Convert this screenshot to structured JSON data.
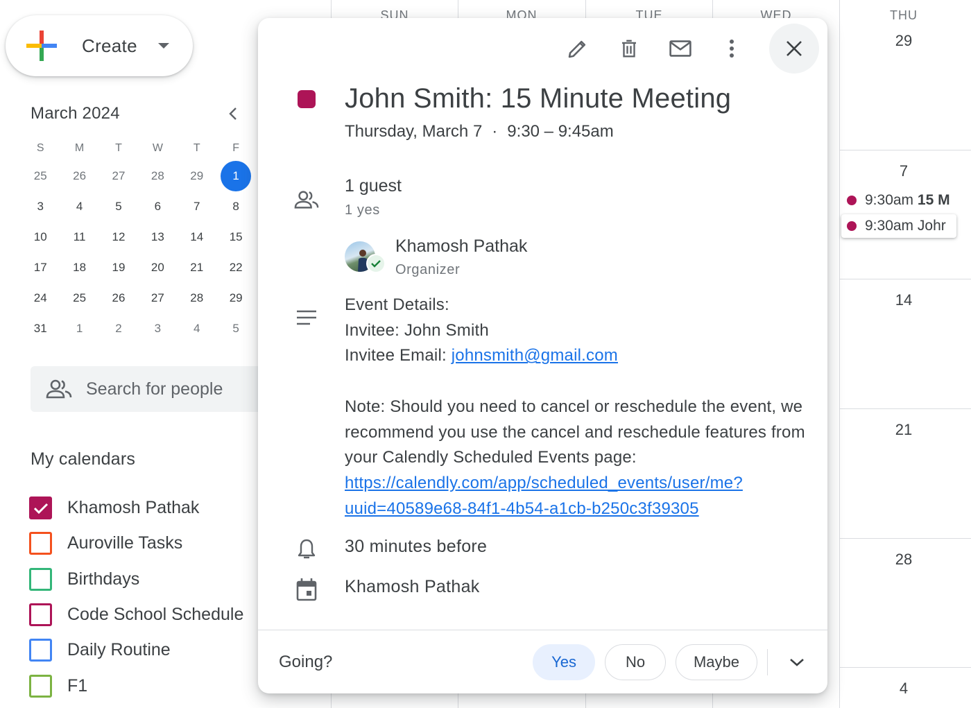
{
  "create": {
    "label": "Create"
  },
  "mini_calendar": {
    "title": "March 2024",
    "weekdays": [
      "S",
      "M",
      "T",
      "W",
      "T",
      "F"
    ],
    "weeks": [
      [
        "25",
        "26",
        "27",
        "28",
        "29",
        "1"
      ],
      [
        "3",
        "4",
        "5",
        "6",
        "7",
        "8"
      ],
      [
        "10",
        "11",
        "12",
        "13",
        "14",
        "15"
      ],
      [
        "17",
        "18",
        "19",
        "20",
        "21",
        "22"
      ],
      [
        "24",
        "25",
        "26",
        "27",
        "28",
        "29"
      ],
      [
        "31",
        "1",
        "2",
        "3",
        "4",
        "5"
      ]
    ]
  },
  "search": {
    "placeholder": "Search for people"
  },
  "my_calendars": {
    "title": "My calendars",
    "items": [
      {
        "name": "Khamosh Pathak",
        "color": "#ad1457",
        "checked": true
      },
      {
        "name": "Auroville Tasks",
        "color": "#f4511e",
        "checked": false
      },
      {
        "name": "Birthdays",
        "color": "#33b679",
        "checked": false
      },
      {
        "name": "Code School Schedule",
        "color": "#ad1457",
        "checked": false
      },
      {
        "name": "Daily Routine",
        "color": "#4285f4",
        "checked": false
      },
      {
        "name": "F1",
        "color": "#7cb342",
        "checked": false
      }
    ]
  },
  "week_view": {
    "col_headers": [
      "SUN",
      "MON",
      "TUE",
      "WED",
      "THU"
    ],
    "thu_dates": [
      "29",
      "7",
      "14",
      "21",
      "28",
      "4"
    ],
    "events": [
      {
        "time": "9:30am",
        "title": "15 M"
      },
      {
        "time": "9:30am",
        "title": "Johr"
      }
    ]
  },
  "event": {
    "color": "#ad1457",
    "title": "John Smith: 15 Minute Meeting",
    "date": "Thursday, March 7",
    "separator": "·",
    "time": "9:30 – 9:45am",
    "guests": {
      "count_label": "1 guest",
      "summary": "1 yes",
      "organizer_name": "Khamosh Pathak",
      "organizer_role": "Organizer"
    },
    "description": {
      "line1": "Event Details:",
      "line2": "Invitee: John Smith",
      "email_label": "Invitee Email: ",
      "email": "johnsmith@gmail.com",
      "note": "Note: Should you need to cancel or reschedule the event, we recommend you use the cancel and reschedule features from your Calendly Scheduled Events page:",
      "link_line1": "https://calendly.com/app/scheduled_events/user/me?",
      "link_line2": "uuid=40589e68-84f1-4b54-a1cb-b250c3f39305"
    },
    "reminder": "30 minutes before",
    "calendar": "Khamosh Pathak"
  },
  "rsvp": {
    "prompt": "Going?",
    "yes": "Yes",
    "no": "No",
    "maybe": "Maybe",
    "selected": "Yes"
  }
}
